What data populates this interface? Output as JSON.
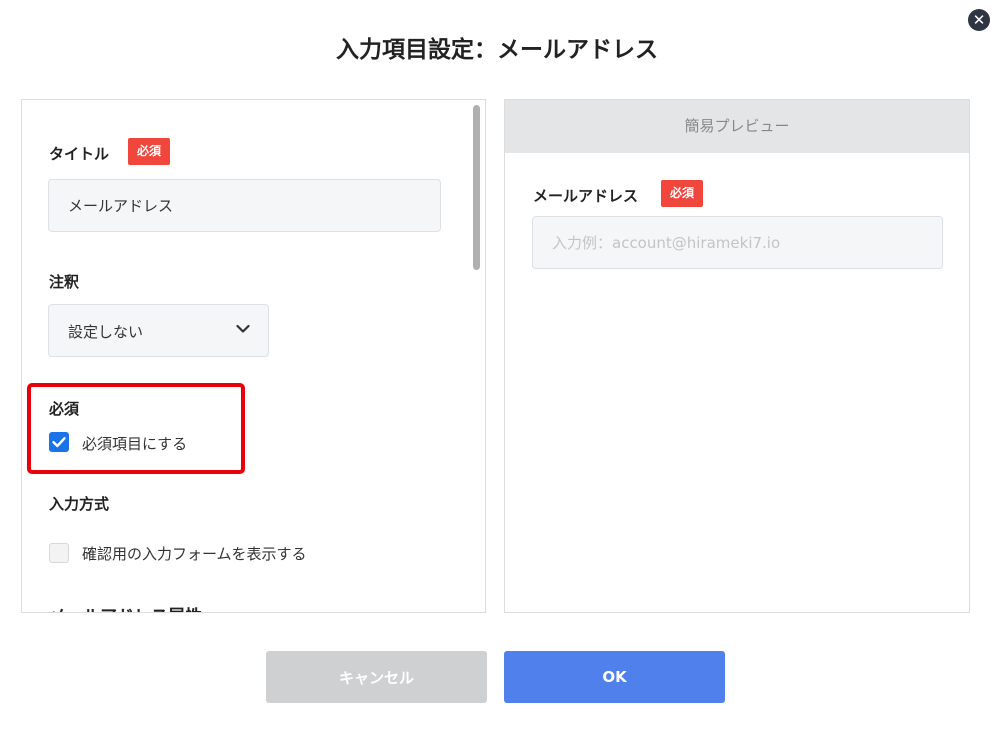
{
  "modal": {
    "title": "入力項目設定：メールアドレス",
    "close_icon": "close-icon",
    "cancel_label": "キャンセル",
    "ok_label": "OK"
  },
  "settings": {
    "title_field": {
      "label": "タイトル",
      "required_badge": "必須",
      "value": "メールアドレス"
    },
    "note_field": {
      "label": "注釈",
      "selected": "設定しない"
    },
    "required_field": {
      "label": "必須",
      "checkbox_label": "必須項目にする",
      "checked": true
    },
    "input_method": {
      "label": "入力方式",
      "checkbox_label": "確認用の入力フォームを表示する",
      "checked": false
    },
    "email_attribute": {
      "label": "メールアドレス属性"
    }
  },
  "preview": {
    "header": "簡易プレビュー",
    "field_label": "メールアドレス",
    "required_badge": "必須",
    "placeholder": "入力例：account@hirameki7.io"
  },
  "colors": {
    "required_badge": "#f0463c",
    "ok_button": "#4f80ec",
    "cancel_button": "#cfd0d2",
    "checkbox_checked": "#1a73e8",
    "highlight": "#e8000b"
  }
}
